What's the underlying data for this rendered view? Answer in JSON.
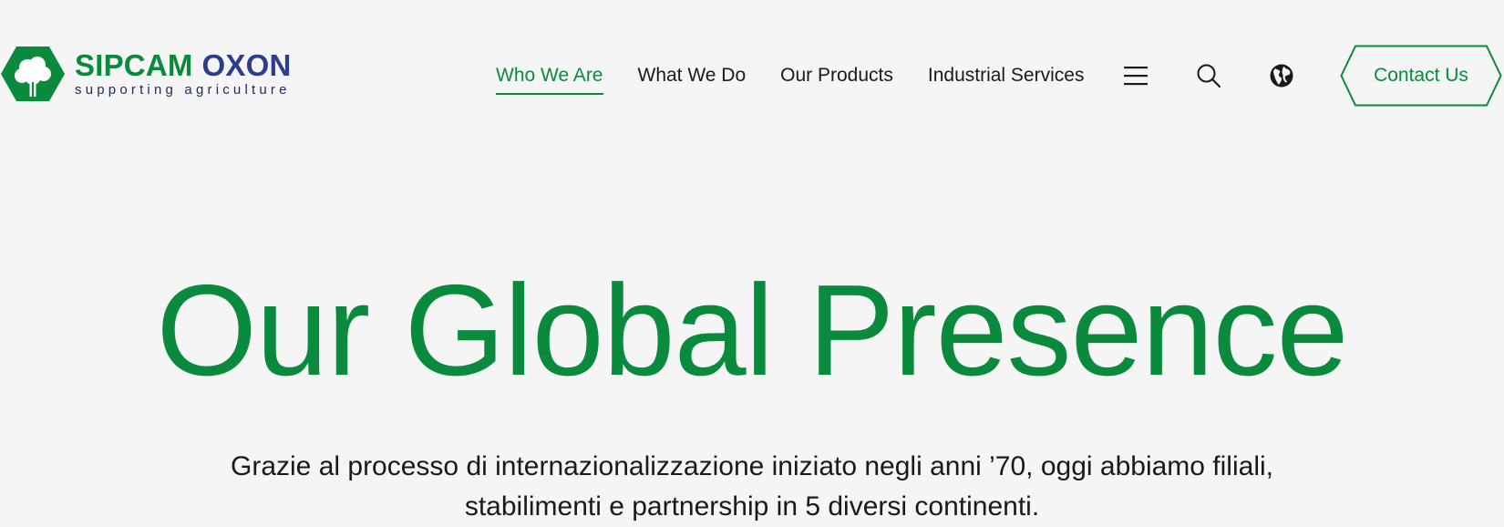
{
  "brand": {
    "name_part1": "SIPCAM",
    "name_part2": "OXON",
    "tagline": "supporting agriculture",
    "colors": {
      "green": "#0a8a3c",
      "navy": "#2c3c8f"
    }
  },
  "nav": {
    "items": [
      {
        "label": "Who We Are",
        "active": true
      },
      {
        "label": "What We Do",
        "active": false
      },
      {
        "label": "Our Products",
        "active": false
      },
      {
        "label": "Industrial Services",
        "active": false
      }
    ]
  },
  "header_icons": {
    "menu": "hamburger-menu-icon",
    "search": "search-icon",
    "language": "globe-icon"
  },
  "cta": {
    "contact_label": "Contact Us"
  },
  "hero": {
    "title": "Our Global Presence",
    "text": "Grazie al processo di internazionalizzazione iniziato negli anni ’70, oggi abbiamo filiali,\nstabilimenti e partnership  in 5 diversi continenti."
  }
}
